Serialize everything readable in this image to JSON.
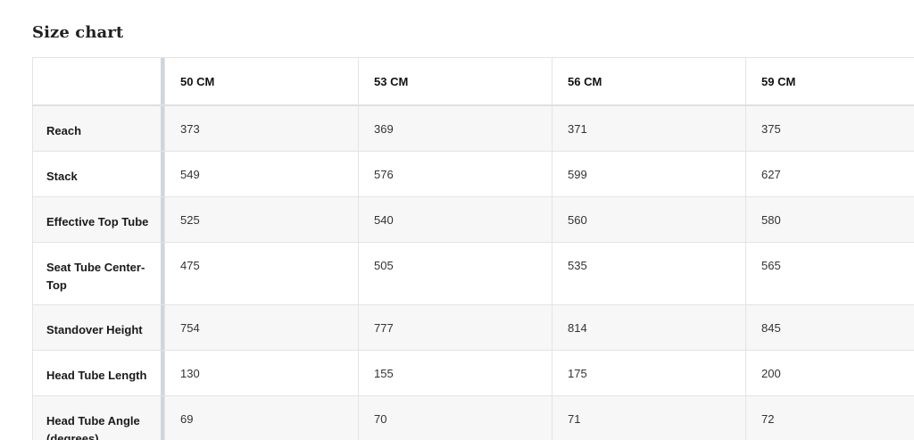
{
  "page": {
    "title": "Size chart"
  },
  "size_chart": {
    "corner_label": "",
    "columns": [
      "50 CM",
      "53 CM",
      "56 CM",
      "59 CM"
    ],
    "rows": [
      {
        "label": "Reach",
        "values": [
          "373",
          "369",
          "371",
          "375"
        ]
      },
      {
        "label": "Stack",
        "values": [
          "549",
          "576",
          "599",
          "627"
        ]
      },
      {
        "label": "Effective Top Tube",
        "values": [
          "525",
          "540",
          "560",
          "580"
        ]
      },
      {
        "label": "Seat Tube Center-Top",
        "values": [
          "475",
          "505",
          "535",
          "565"
        ]
      },
      {
        "label": "Standover Height",
        "values": [
          "754",
          "777",
          "814",
          "845"
        ]
      },
      {
        "label": "Head Tube Length",
        "values": [
          "130",
          "155",
          "175",
          "200"
        ]
      },
      {
        "label": "Head Tube Angle (degrees)",
        "values": [
          "69",
          "70",
          "71",
          "72"
        ]
      }
    ]
  }
}
